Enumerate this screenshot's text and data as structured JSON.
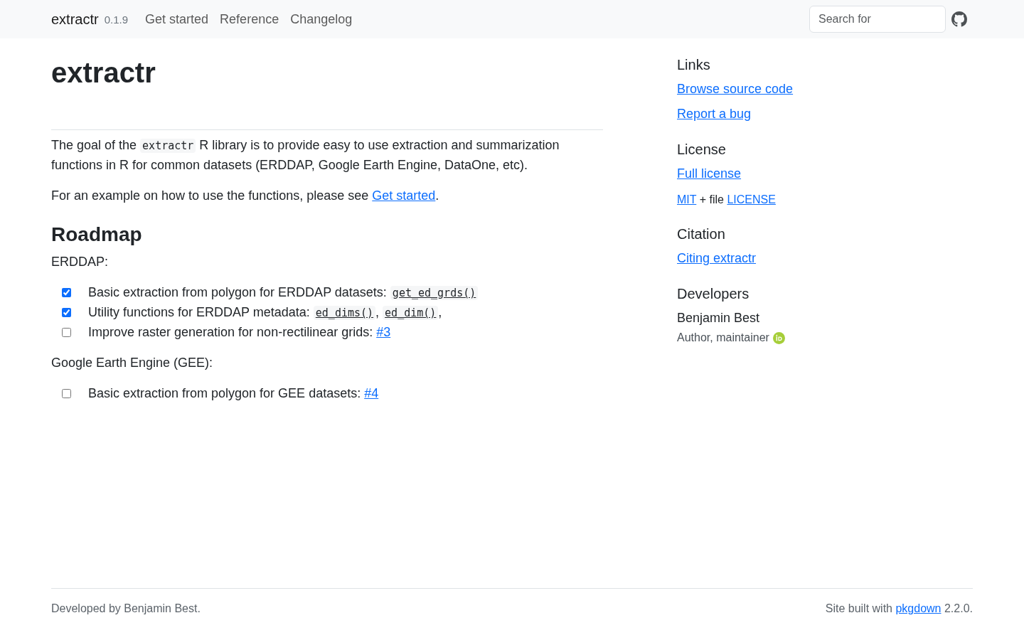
{
  "navbar": {
    "brand": "extractr",
    "version": "0.1.9",
    "links": [
      {
        "label": "Get started"
      },
      {
        "label": "Reference"
      },
      {
        "label": "Changelog"
      }
    ],
    "search": {
      "placeholder": "Search for"
    }
  },
  "main": {
    "title": "extractr",
    "paragraphs": [
      [
        {
          "kind": "text",
          "text": "The goal of the "
        },
        {
          "kind": "code",
          "text": "extractr"
        },
        {
          "kind": "text",
          "text": " R library is to provide easy to use extraction and summarization functions in R for common datasets (ERDDAP, Google Earth Engine, DataOne, etc)."
        }
      ],
      [
        {
          "kind": "text",
          "text": "For an example on how to use the functions, please see "
        },
        {
          "kind": "link",
          "text": "Get started"
        },
        {
          "kind": "text",
          "text": "."
        }
      ]
    ],
    "roadmap": {
      "heading": "Roadmap",
      "groups": [
        {
          "label": "ERDDAP:",
          "tasks": [
            {
              "checked": true,
              "parts": [
                {
                  "kind": "text",
                  "text": "Basic extraction from polygon for ERDDAP datasets: "
                },
                {
                  "kind": "code_link",
                  "text": "get_ed_grds()"
                }
              ]
            },
            {
              "checked": true,
              "parts": [
                {
                  "kind": "text",
                  "text": "Utility functions for ERDDAP metadata: "
                },
                {
                  "kind": "code_link",
                  "text": "ed_dims()"
                },
                {
                  "kind": "text",
                  "text": ", "
                },
                {
                  "kind": "code_link",
                  "text": "ed_dim()"
                },
                {
                  "kind": "text",
                  "text": ","
                }
              ]
            },
            {
              "checked": false,
              "parts": [
                {
                  "kind": "text",
                  "text": "Improve raster generation for non-rectilinear grids: "
                },
                {
                  "kind": "link",
                  "text": "#3"
                }
              ]
            }
          ]
        },
        {
          "label": "Google Earth Engine (GEE):",
          "tasks": [
            {
              "checked": false,
              "parts": [
                {
                  "kind": "text",
                  "text": "Basic extraction from polygon for GEE datasets: "
                },
                {
                  "kind": "link",
                  "text": "#4"
                }
              ]
            }
          ]
        }
      ]
    }
  },
  "sidebar": {
    "sections": [
      {
        "heading": "Links",
        "items": [
          {
            "kind": "link",
            "text": "Browse source code"
          },
          {
            "kind": "link",
            "text": "Report a bug"
          }
        ]
      },
      {
        "heading": "License",
        "items": [
          {
            "kind": "link",
            "text": "Full license"
          },
          {
            "kind": "note",
            "parts": [
              {
                "kind": "link",
                "text": "MIT"
              },
              {
                "kind": "text",
                "text": " + file "
              },
              {
                "kind": "link",
                "text": "LICENSE"
              }
            ]
          }
        ]
      },
      {
        "heading": "Citation",
        "items": [
          {
            "kind": "link",
            "text": "Citing extractr"
          }
        ]
      },
      {
        "heading": "Developers",
        "items": [
          {
            "kind": "person",
            "name": "Benjamin Best",
            "role": "Author, maintainer",
            "orcid": true
          }
        ]
      }
    ]
  },
  "footer": {
    "left": "Developed by Benjamin Best.",
    "right": [
      {
        "kind": "text",
        "text": "Site built with "
      },
      {
        "kind": "link",
        "text": "pkgdown"
      },
      {
        "kind": "text",
        "text": " 2.2.0."
      }
    ]
  }
}
